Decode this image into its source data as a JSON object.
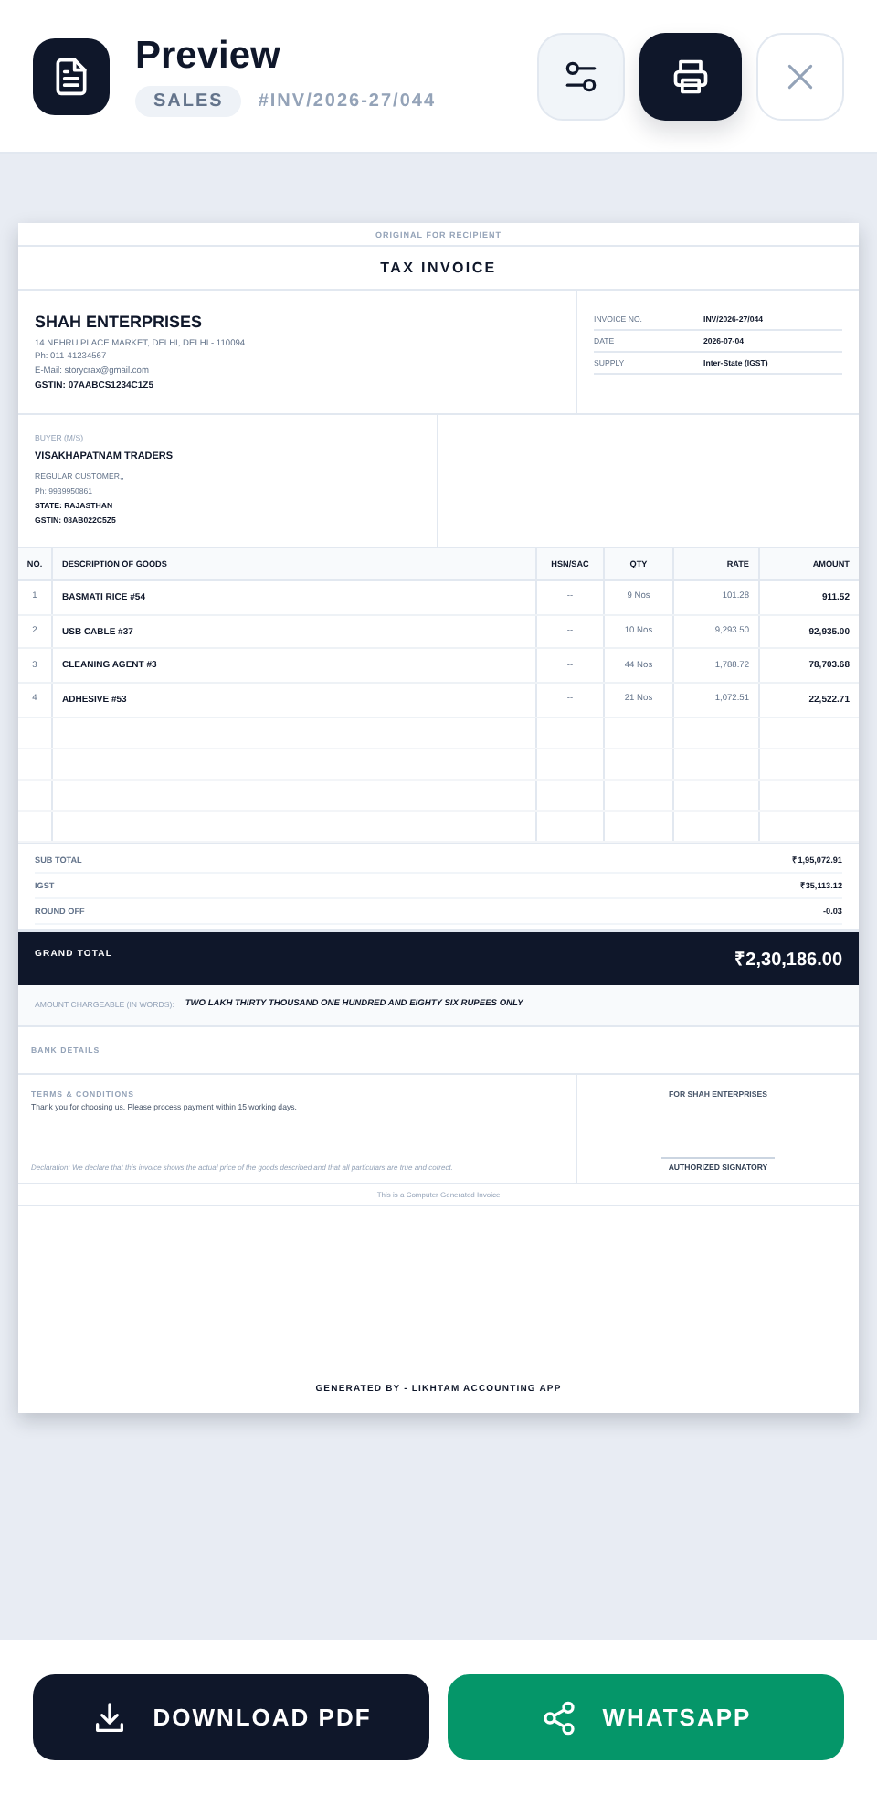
{
  "header": {
    "title": "Preview",
    "tag": "SALES",
    "number": "#INV/2026-27/044"
  },
  "invoice": {
    "copy_label": "ORIGINAL FOR RECIPIENT",
    "title": "TAX INVOICE",
    "seller": {
      "name": "SHAH ENTERPRISES",
      "address": "14 NEHRU PLACE MARKET, DELHI, DELHI - 110094",
      "phone": "Ph: 011-41234567",
      "email": "E-Mail: storycrax@gmail.com",
      "gstin": "GSTIN: 07AABCS1234C1Z5"
    },
    "meta": [
      {
        "label": "INVOICE NO.",
        "value": "INV/2026-27/044"
      },
      {
        "label": "DATE",
        "value": "2026-07-04"
      },
      {
        "label": "SUPPLY",
        "value": "Inter-State (IGST)"
      }
    ],
    "buyer": {
      "label": "BUYER (M/S)",
      "name": "VISAKHAPATNAM TRADERS",
      "type": "REGULAR CUSTOMER,,",
      "phone": "Ph: 9939950861",
      "state": "STATE: RAJASTHAN",
      "gstin": "GSTIN: 08AB022C5Z5"
    },
    "table": {
      "columns": [
        "NO.",
        "DESCRIPTION OF GOODS",
        "HSN/SAC",
        "QTY",
        "RATE",
        "AMOUNT"
      ],
      "rows": [
        {
          "no": "1",
          "description": "BASMATI RICE #54",
          "hsn": "--",
          "qty": "9 Nos",
          "rate": "101.28",
          "amount": "911.52"
        },
        {
          "no": "2",
          "description": "USB CABLE #37",
          "hsn": "--",
          "qty": "10 Nos",
          "rate": "9,293.50",
          "amount": "92,935.00"
        },
        {
          "no": "3",
          "description": "CLEANING AGENT #3",
          "hsn": "--",
          "qty": "44 Nos",
          "rate": "1,788.72",
          "amount": "78,703.68"
        },
        {
          "no": "4",
          "description": "ADHESIVE #53",
          "hsn": "--",
          "qty": "21 Nos",
          "rate": "1,072.51",
          "amount": "22,522.71"
        }
      ]
    },
    "totals": [
      {
        "label": "SUB TOTAL",
        "value": "₹1,95,072.91"
      },
      {
        "label": "IGST",
        "value": "₹35,113.12"
      },
      {
        "label": "ROUND OFF",
        "value": "-0.03"
      }
    ],
    "grand_total": {
      "label": "GRAND TOTAL",
      "value": "₹2,30,186.00"
    },
    "amount_words": {
      "label": "AMOUNT CHARGEABLE (IN WORDS):",
      "value": "TWO LAKH THIRTY THOUSAND ONE HUNDRED AND EIGHTY SIX RUPEES ONLY"
    },
    "bank_details_label": "BANK DETAILS",
    "terms": {
      "label": "TERMS & CONDITIONS",
      "text": "Thank you for choosing us. Please process payment within 15 working days."
    },
    "declaration": "Declaration: We declare that this invoice shows the actual price of the goods described and that all particulars are true and correct.",
    "signatory": {
      "company": "FOR SHAH ENTERPRISES",
      "label": "AUTHORIZED SIGNATORY"
    },
    "computer_generated": "This is a Computer Generated Invoice",
    "generated_by": "GENERATED BY - LIKHTAM ACCOUNTING APP"
  },
  "buttons": [
    {
      "kind": "download",
      "label": "DOWNLOAD PDF"
    },
    {
      "kind": "whatsapp",
      "label": "WHATSAPP"
    }
  ]
}
